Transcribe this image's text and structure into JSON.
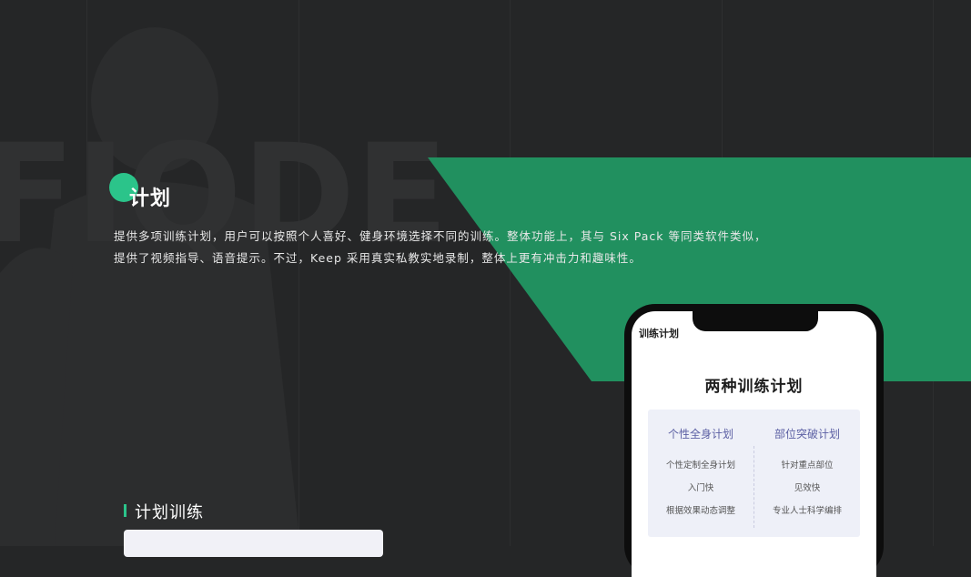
{
  "colors": {
    "background": "#252627",
    "accent_green": "#21905f",
    "dot_green": "#2bc48a",
    "plan_title": "#5b5fa3"
  },
  "section": {
    "title": "计划",
    "description_lines": [
      "提供多项训练计划，用户可以按照个人喜好、健身环境选择不同的训练。整体功能上，其与 Six Pack 等同类软件类似，",
      "提供了视频指导、语音提示。不过，Keep 采用真实私教实地录制，整体上更有冲击力和趣味性。"
    ]
  },
  "subsection": {
    "title": "计划训练"
  },
  "phone": {
    "top_label": "训练计划",
    "heading": "两种训练计划",
    "plans": [
      {
        "title": "个性全身计划",
        "items": [
          "个性定制全身计划",
          "入门快",
          "根据效果动态调整"
        ]
      },
      {
        "title": "部位突破计划",
        "items": [
          "针对重点部位",
          "见效快",
          "专业人士科学编排"
        ]
      }
    ]
  }
}
